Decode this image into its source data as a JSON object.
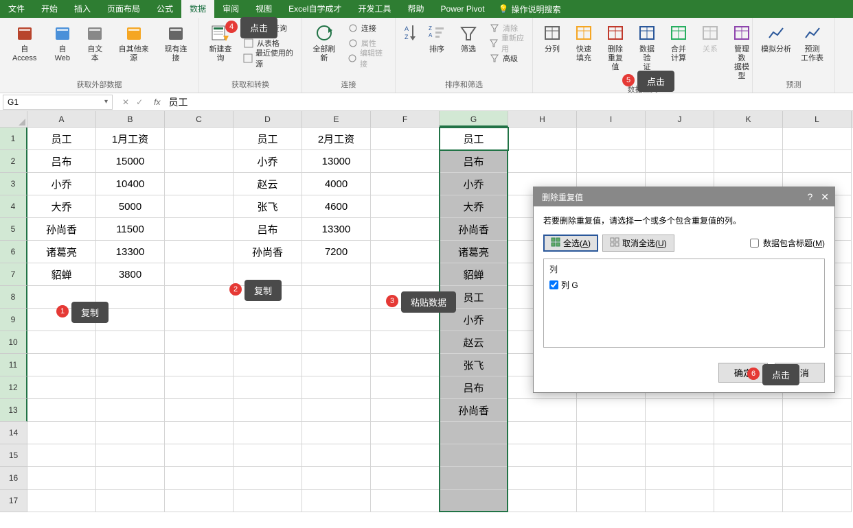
{
  "menubar": {
    "tabs": [
      "文件",
      "开始",
      "插入",
      "页面布局",
      "公式",
      "数据",
      "审阅",
      "视图",
      "Excel自学成才",
      "开发工具",
      "帮助",
      "Power Pivot"
    ],
    "active_index": 5,
    "tell_me": "操作说明搜索"
  },
  "ribbon": {
    "groups": {
      "external": {
        "label": "获取外部数据",
        "items": [
          "自 Access",
          "自 Web",
          "自文本",
          "自其他来源",
          "现有连接"
        ]
      },
      "get_transform": {
        "label": "获取和转换",
        "new_query": "新建查询",
        "small": [
          "显示查询",
          "从表格",
          "最近使用的源"
        ]
      },
      "connections": {
        "label": "连接",
        "refresh": "全部刷新",
        "small": [
          "连接",
          "属性",
          "编辑链接"
        ]
      },
      "sort_filter": {
        "label": "排序和筛选",
        "sort": "排序",
        "filter": "筛选",
        "small": [
          "清除",
          "重新应用",
          "高级"
        ]
      },
      "data_tools": {
        "label": "数据工具",
        "items": [
          "分列",
          "快速填充",
          "删除重复值",
          "数据验证",
          "合并计算",
          "关系",
          "管理数据模型"
        ]
      },
      "forecast": {
        "label": "预测",
        "items": [
          "模拟分析",
          "预测工作表"
        ]
      }
    }
  },
  "namebox": "G1",
  "formula_value": "员工",
  "columns": [
    "A",
    "B",
    "C",
    "D",
    "E",
    "F",
    "G",
    "H",
    "I",
    "J",
    "K",
    "L"
  ],
  "selected_col_index": 6,
  "rows": 17,
  "cells": {
    "A1": "员工",
    "B1": "1月工资",
    "D1": "员工",
    "E1": "2月工资",
    "G1": "员工",
    "A2": "吕布",
    "B2": "15000",
    "D2": "小乔",
    "E2": "13000",
    "G2": "吕布",
    "A3": "小乔",
    "B3": "10400",
    "D3": "赵云",
    "E3": "4000",
    "G3": "小乔",
    "A4": "大乔",
    "B4": "5000",
    "D4": "张飞",
    "E4": "4600",
    "G4": "大乔",
    "A5": "孙尚香",
    "B5": "11500",
    "D5": "吕布",
    "E5": "13300",
    "G5": "孙尚香",
    "A6": "诸葛亮",
    "B6": "13300",
    "D6": "孙尚香",
    "E6": "7200",
    "G6": "诸葛亮",
    "A7": "貂蝉",
    "B7": "3800",
    "G7": "貂蝉",
    "G8": "员工",
    "G9": "小乔",
    "G10": "赵云",
    "G11": "张飞",
    "G12": "吕布",
    "G13": "孙尚香"
  },
  "dialog": {
    "title": "删除重复值",
    "desc": "若要删除重复值，请选择一个或多个包含重复值的列。",
    "select_all": "全选(A)",
    "deselect_all": "取消全选(U)",
    "header_checkbox": "数据包含标题(M)",
    "list_header": "列",
    "list_item": "列 G",
    "ok": "确定",
    "cancel": "取消",
    "help": "?",
    "close": "✕"
  },
  "callouts": {
    "c1": {
      "num": "1",
      "text": "复制"
    },
    "c2": {
      "num": "2",
      "text": "复制"
    },
    "c3": {
      "num": "3",
      "text": "粘贴数据"
    },
    "c4": {
      "num": "4",
      "text": "点击"
    },
    "c5": {
      "num": "5",
      "text": "点击"
    },
    "c6": {
      "num": "6",
      "text": "点击"
    }
  }
}
